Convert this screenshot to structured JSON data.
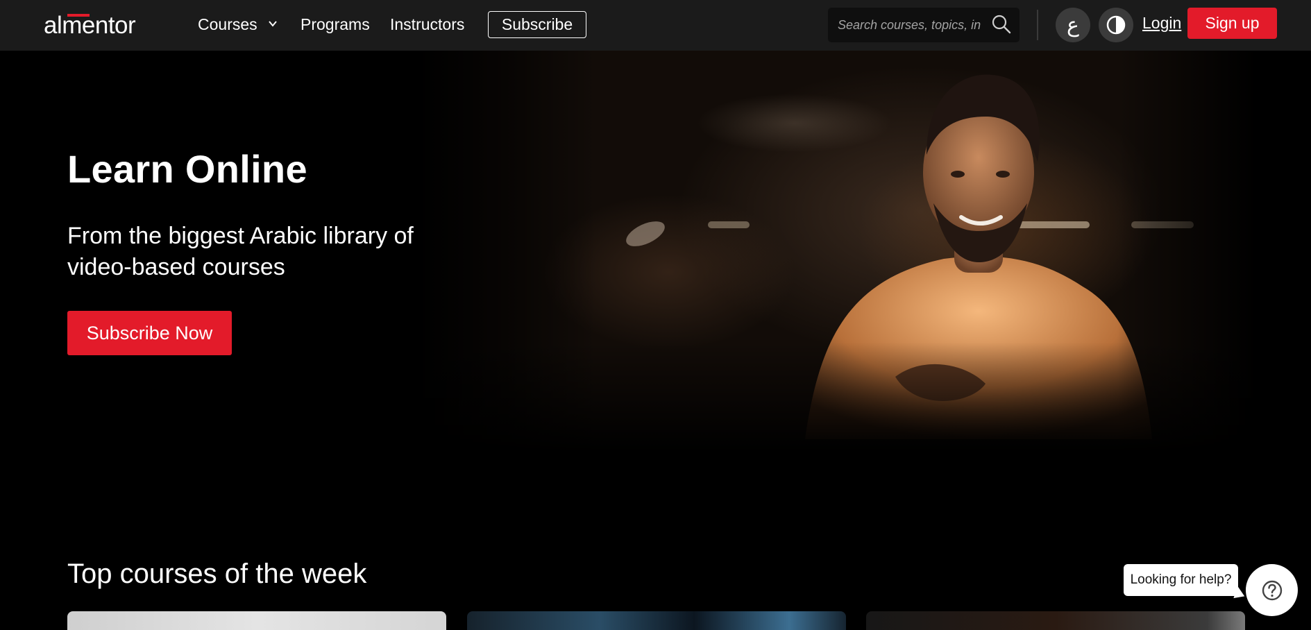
{
  "nav": {
    "logo_text": "almentor",
    "courses_label": "Courses",
    "programs_label": "Programs",
    "instructors_label": "Instructors",
    "subscribe_label": "Subscribe",
    "search_placeholder": "Search courses, topics, in",
    "lang_glyph": "ع",
    "login_label": "Login",
    "signup_label": "Sign up"
  },
  "hero": {
    "title": "Learn Online",
    "subtitle": "From the biggest Arabic library of video-based courses",
    "cta_label": "Subscribe Now"
  },
  "top_courses": {
    "title": "Top courses of the week"
  },
  "help": {
    "bubble_text": "Looking for help?"
  },
  "colors": {
    "brand_red": "#e31b2a",
    "nav_bg": "#1b1b1b",
    "page_bg": "#000000"
  },
  "icons": [
    "chevron-down-icon",
    "search-icon",
    "arabic-language-icon",
    "theme-toggle-icon",
    "help-icon"
  ]
}
